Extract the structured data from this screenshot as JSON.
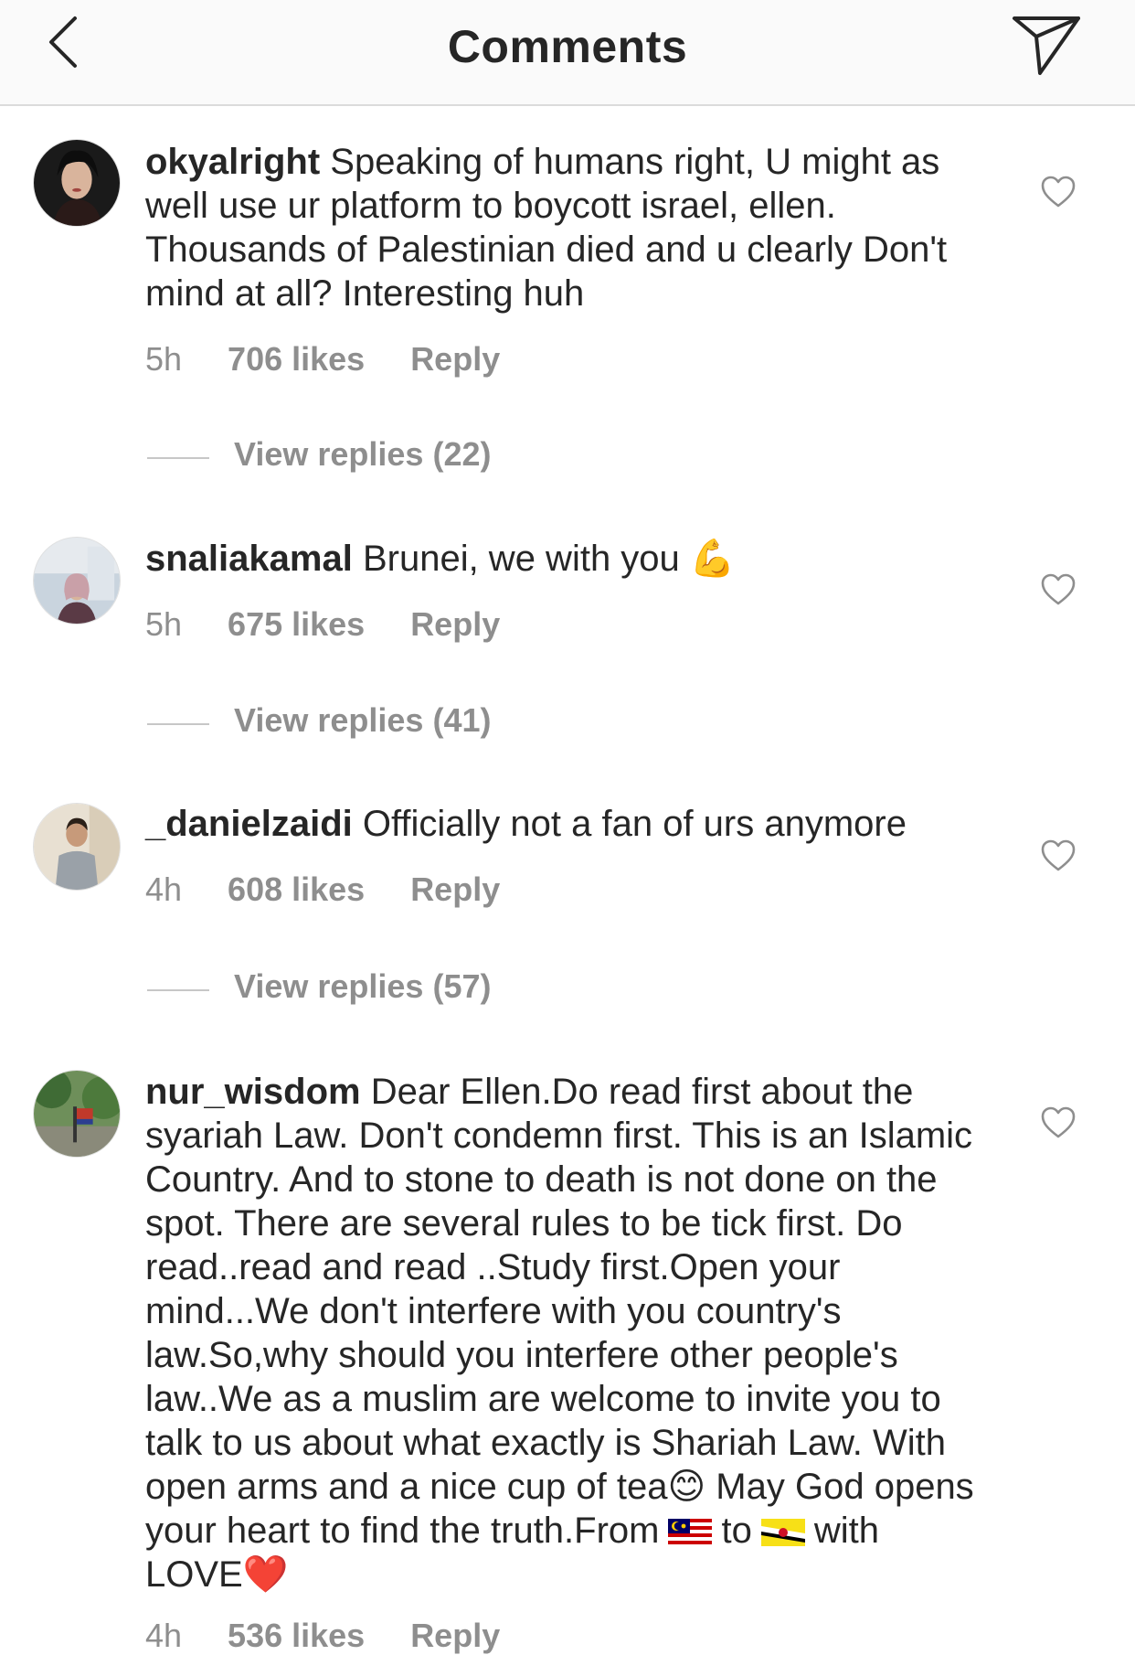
{
  "header": {
    "title": "Comments",
    "back_icon": "chevron-left-icon",
    "share_icon": "paper-plane-icon"
  },
  "comments": [
    {
      "username": "okyalright",
      "text": "Speaking of humans right, U might as well use ur platform to boycott israel, ellen. Thousands of Palestinian died and u clearly Don't mind at all? Interesting huh",
      "time": "5h",
      "likes": "706 likes",
      "reply": "Reply",
      "view_replies": "View replies (22)"
    },
    {
      "username": "snaliakamal",
      "text": "Brunei, we with you",
      "emoji": "💪",
      "time": "5h",
      "likes": "675 likes",
      "reply": "Reply",
      "view_replies": "View replies (41)"
    },
    {
      "username": "_danielzaidi",
      "text": "Officially not a fan of urs anymore",
      "time": "4h",
      "likes": "608 likes",
      "reply": "Reply",
      "view_replies": "View replies (57)"
    },
    {
      "username": "nur_wisdom",
      "text": "Dear Ellen.Do read first about the syariah Law. Don't condemn first. This is an Islamic Country. And to stone to death is not done on the spot. There are several rules to be tick first. Do read..read and read ..Study first.Open your mind...We don't interfere with you country's law.So,why should you interfere other people's law..We as a muslim are welcome to invite you  to  talk to us about what exactly is Shariah Law. With open arms and a nice cup of tea",
      "smile_emoji": "😊",
      "text_2": " May God opens your heart to find the truth.From",
      "text_3": "to",
      "text_4": "with LOVE",
      "heart_emoji": "❤️",
      "flag_1": "malaysia-flag-icon",
      "flag_2": "brunei-flag-icon",
      "time": "4h",
      "likes": "536 likes",
      "reply": "Reply"
    }
  ],
  "icons": {
    "like": "heart-outline-icon"
  },
  "colors": {
    "text": "#262626",
    "secondary": "#8e8e8e",
    "divider": "#dbdbdb",
    "header_bg": "#fafafa"
  }
}
